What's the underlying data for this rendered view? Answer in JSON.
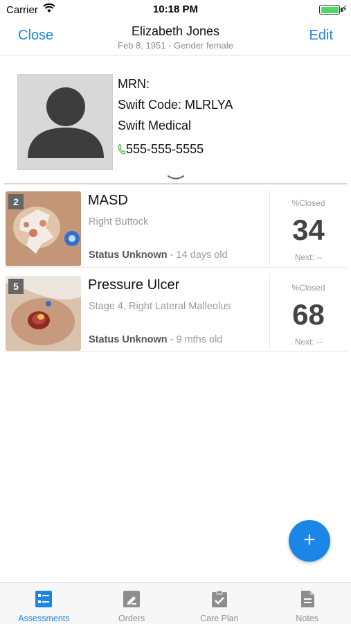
{
  "status_bar": {
    "carrier": "Carrier",
    "time": "10:18 PM"
  },
  "nav": {
    "close_label": "Close",
    "edit_label": "Edit",
    "title": "Elizabeth Jones",
    "subtitle": "Feb 8, 1951 - Gender female"
  },
  "patient": {
    "mrn": "MRN:",
    "swift_code": "Swift Code: MLRLYA",
    "facility": "Swift Medical",
    "phone": "555-555-5555"
  },
  "wounds": [
    {
      "number": "2",
      "name": "MASD",
      "location": "Right Buttock",
      "status": "Status Unknown",
      "age": " - 14 days old",
      "pct_label": "%Closed",
      "pct_value": "34",
      "next": "Next: --"
    },
    {
      "number": "5",
      "name": "Pressure Ulcer",
      "location": "Stage 4, Right Lateral Malleolus",
      "status": "Status Unknown",
      "age": " - 9 mths old",
      "pct_label": "%Closed",
      "pct_value": "68",
      "next": "Next: --"
    }
  ],
  "fab": {
    "symbol": "+"
  },
  "tabs": [
    {
      "label": "Assessments",
      "icon": "assessments-icon",
      "active": true
    },
    {
      "label": "Orders",
      "icon": "orders-icon",
      "active": false
    },
    {
      "label": "Care Plan",
      "icon": "care-plan-icon",
      "active": false
    },
    {
      "label": "Notes",
      "icon": "notes-icon",
      "active": false
    }
  ],
  "colors": {
    "accent": "#1c86e8",
    "phone_icon": "#4caf50",
    "battery": "#4cd964"
  }
}
